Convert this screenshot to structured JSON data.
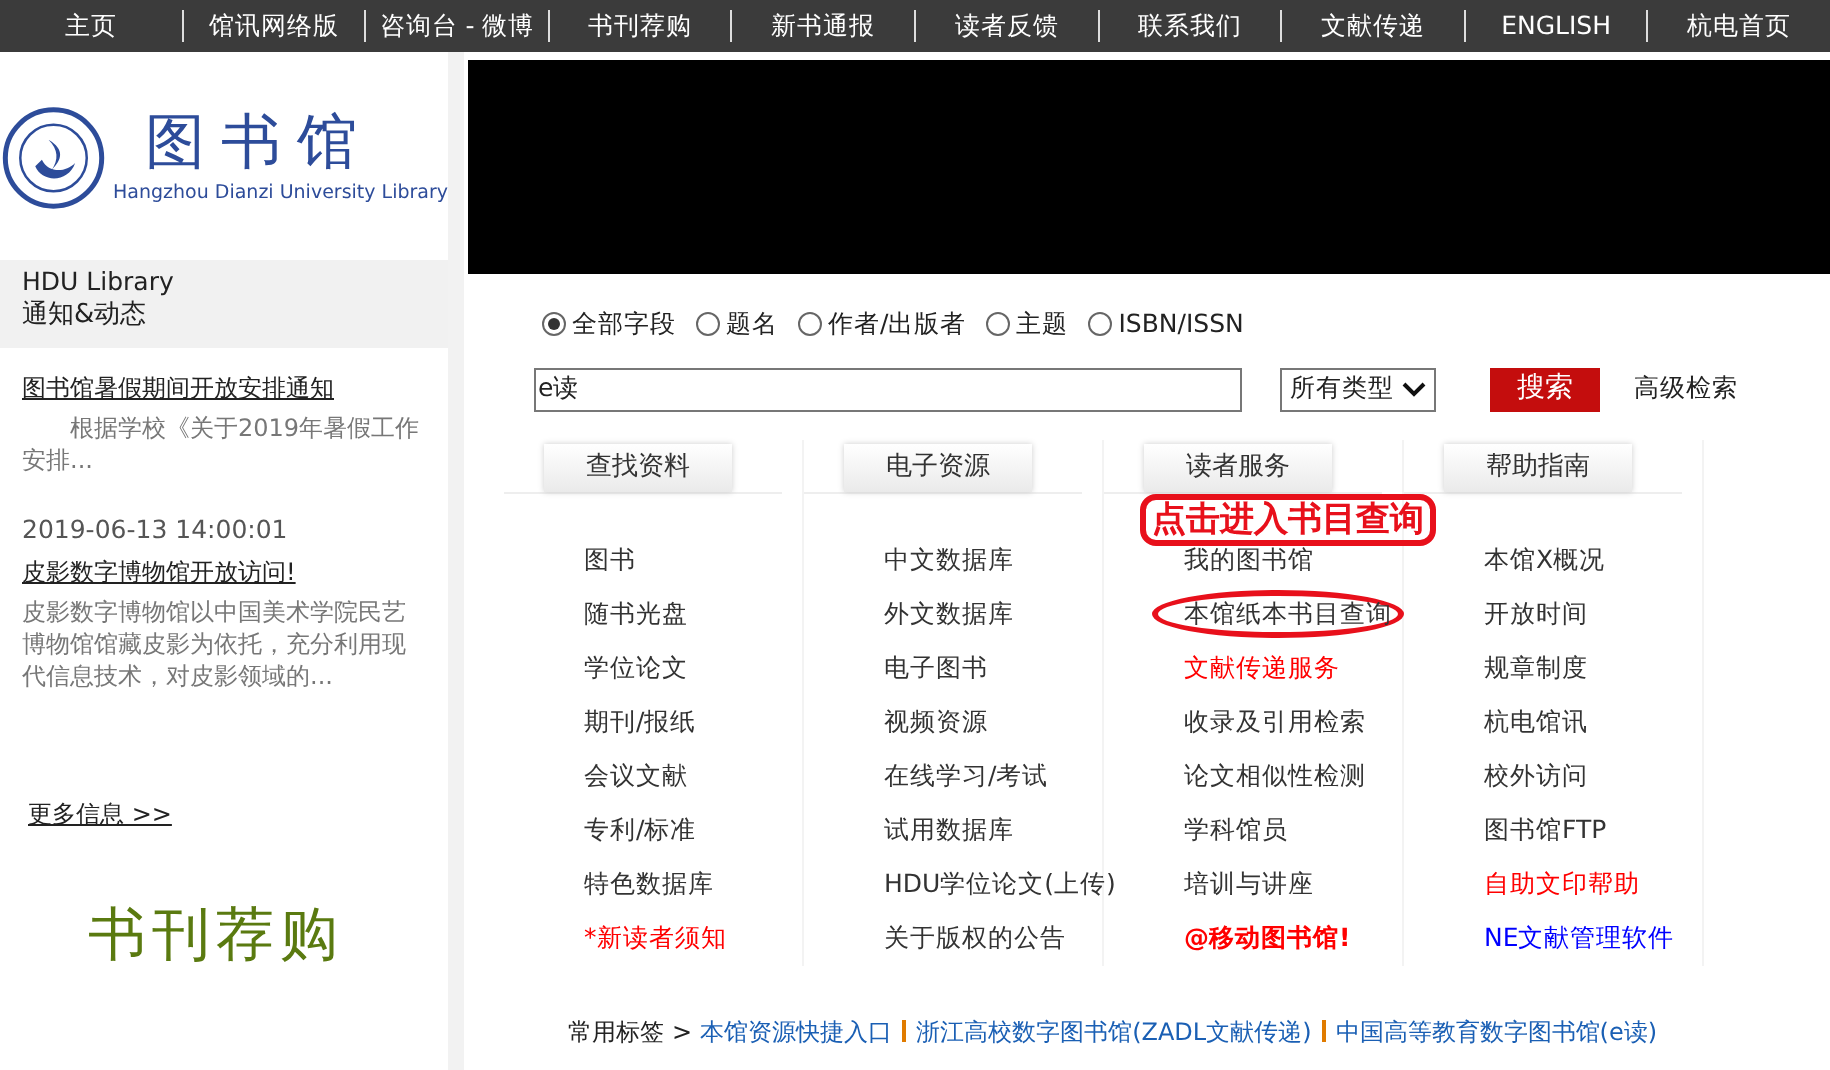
{
  "nav": [
    "主页",
    "馆讯网络版",
    "咨询台 - 微博",
    "书刊荐购",
    "新书通报",
    "读者反馈",
    "联系我们",
    "文献传递",
    "ENGLISH",
    "杭电首页"
  ],
  "logo": {
    "title": "图书馆",
    "subtitle": "Hangzhou Dianzi University Library"
  },
  "news_panel": {
    "title": "HDU Library",
    "subtitle": "通知&动态"
  },
  "news": [
    {
      "title": "图书馆暑假期间开放安排通知",
      "summary": "　　根据学校《关于2019年暑假工作安排..."
    },
    {
      "date": "2019-06-13 14:00:01",
      "title": "皮影数字博物馆开放访问!",
      "summary": "皮影数字博物馆以中国美术学院民艺博物馆馆藏皮影为依托，充分利用现代信息技术，对皮影领域的..."
    }
  ],
  "more_link": "更多信息 >>",
  "recommend_banner": "书刊荐购",
  "search": {
    "scopes": [
      {
        "label": "全部字段",
        "selected": true
      },
      {
        "label": "题名",
        "selected": false
      },
      {
        "label": "作者/出版者",
        "selected": false
      },
      {
        "label": "主题",
        "selected": false
      },
      {
        "label": "ISBN/ISSN",
        "selected": false
      }
    ],
    "value": "e读",
    "type": "所有类型",
    "button": "搜索",
    "advanced": "高级检索"
  },
  "columns": [
    {
      "title": "查找资料",
      "items": [
        {
          "label": "图书",
          "color": "#333333"
        },
        {
          "label": "随书光盘",
          "color": "#333333"
        },
        {
          "label": "学位论文",
          "color": "#333333"
        },
        {
          "label": "期刊/报纸",
          "color": "#333333"
        },
        {
          "label": "会议文献",
          "color": "#333333"
        },
        {
          "label": "专利/标准",
          "color": "#333333"
        },
        {
          "label": "特色数据库",
          "color": "#333333"
        },
        {
          "label": "*新读者须知",
          "color": "#ff0000"
        }
      ]
    },
    {
      "title": "电子资源",
      "items": [
        {
          "label": "中文数据库",
          "color": "#333333"
        },
        {
          "label": "外文数据库",
          "color": "#333333"
        },
        {
          "label": "电子图书",
          "color": "#333333"
        },
        {
          "label": "视频资源",
          "color": "#333333"
        },
        {
          "label": "在线学习/考试",
          "color": "#333333"
        },
        {
          "label": "试用数据库",
          "color": "#333333"
        },
        {
          "label": "HDU学位论文(上传)",
          "color": "#333333"
        },
        {
          "label": "关于版权的公告",
          "color": "#333333"
        }
      ]
    },
    {
      "title": "读者服务",
      "items": [
        {
          "label": "我的图书馆",
          "color": "#333333"
        },
        {
          "label": "本馆纸本书目查询",
          "color": "#333333",
          "circled": true
        },
        {
          "label": "文献传递服务",
          "color": "#ff0000"
        },
        {
          "label": "收录及引用检索",
          "color": "#333333"
        },
        {
          "label": "论文相似性检测",
          "color": "#333333"
        },
        {
          "label": "学科馆员",
          "color": "#333333"
        },
        {
          "label": "培训与讲座",
          "color": "#333333"
        },
        {
          "label": "@移动图书馆!",
          "color": "#ff0000",
          "bold": true
        }
      ]
    },
    {
      "title": "帮助指南",
      "items": [
        {
          "label": "本馆X概况",
          "color": "#333333"
        },
        {
          "label": "开放时间",
          "color": "#333333"
        },
        {
          "label": "规章制度",
          "color": "#333333"
        },
        {
          "label": "杭电馆讯",
          "color": "#333333"
        },
        {
          "label": "校外访问",
          "color": "#333333"
        },
        {
          "label": "图书馆FTP",
          "color": "#333333"
        },
        {
          "label": "自助文印帮助",
          "color": "#ff0000"
        },
        {
          "label": "NE文献管理软件",
          "color": "#0000ff"
        }
      ]
    }
  ],
  "annotation": "点击进入书目查询",
  "footer": {
    "label": "常用标签",
    "separator": ">",
    "links": [
      "本馆资源快捷入口",
      "浙江高校数字图书馆(ZADL文献传递)",
      "中国高等教育数字图书馆(e读)"
    ]
  }
}
